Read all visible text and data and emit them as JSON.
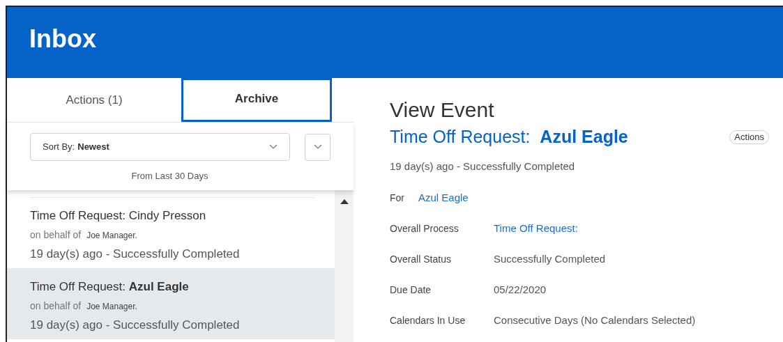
{
  "header": {
    "title": "Inbox"
  },
  "tabs": [
    {
      "label": "Actions (1)",
      "selected": false
    },
    {
      "label": "Archive",
      "selected": true
    }
  ],
  "sort": {
    "label": "Sort By:",
    "value": "Newest"
  },
  "filter_note": "From Last 30 Days",
  "items": [
    {
      "title": "Time Off Request: Cindy Presson",
      "behalf_label": "on behalf of",
      "behalf_name": "Joe Manager.",
      "status": "19 day(s) ago - Successfully Completed",
      "selected": false
    },
    {
      "title": "Time Off Request: **Azul Eagle**",
      "behalf_label": "on behalf of",
      "behalf_name": "Joe Manager.",
      "status": "19 day(s) ago - Successfully Completed",
      "selected": true
    }
  ],
  "detail": {
    "heading": "View Event",
    "title": "Time Off Request:  **Azul Eagle**",
    "actions_button": "Actions",
    "status_line": "19 day(s) ago - Successfully Completed",
    "fields": [
      {
        "label": "For",
        "value": "Azul Eagle",
        "kind": "link"
      },
      {
        "label": "Overall Process",
        "value": "Time Off Request:",
        "kind": "link"
      },
      {
        "label": "Overall Status",
        "value": "Successfully Completed",
        "kind": "text"
      },
      {
        "label": "Due Date",
        "value": "05/22/2020",
        "kind": "text"
      },
      {
        "label": "Calendars In Use",
        "value": "Consecutive Days (No Calendars Selected)",
        "kind": "text"
      }
    ]
  }
}
